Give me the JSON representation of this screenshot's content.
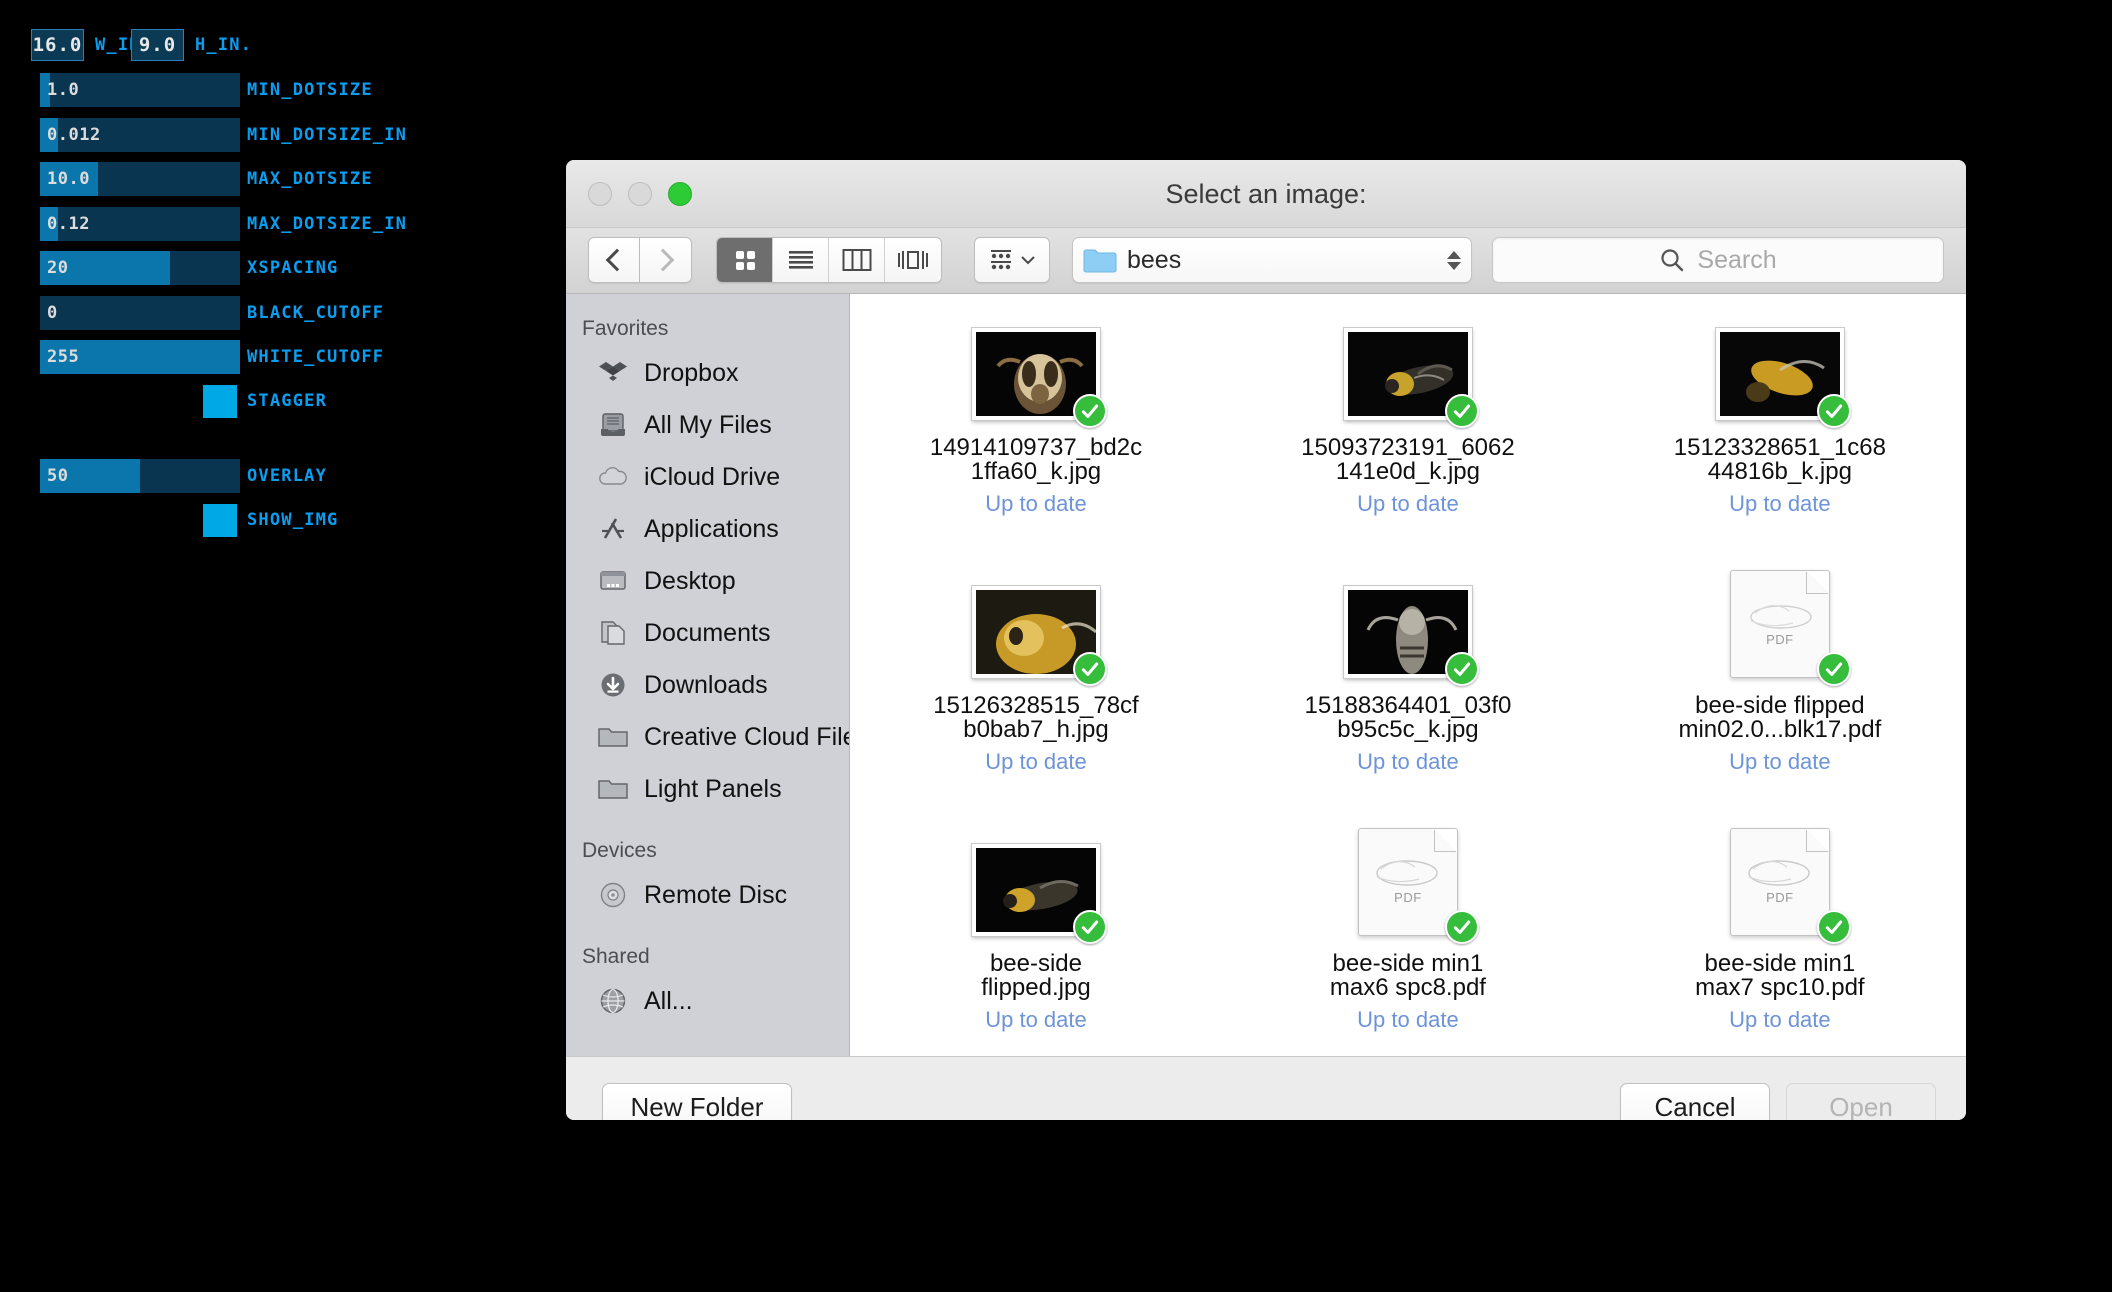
{
  "control_panel": {
    "number_fields": [
      {
        "name": "w_in",
        "value": "16.0",
        "label": "W_IN."
      },
      {
        "name": "h_in",
        "value": "9.0",
        "label": "H_IN."
      }
    ],
    "sliders": [
      {
        "name": "min_dotsize",
        "value": "1.0",
        "label": "MIN_DOTSIZE",
        "fill_pct": 5
      },
      {
        "name": "min_dotsize_in",
        "value": "0.012",
        "label": "MIN_DOTSIZE_IN",
        "fill_pct": 9
      },
      {
        "name": "max_dotsize",
        "value": "10.0",
        "label": "MAX_DOTSIZE",
        "fill_pct": 29
      },
      {
        "name": "max_dotsize_in",
        "value": "0.12",
        "label": "MAX_DOTSIZE_IN",
        "fill_pct": 9
      },
      {
        "name": "xspacing",
        "value": "20",
        "label": "XSPACING",
        "fill_pct": 65
      },
      {
        "name": "black_cutoff",
        "value": "0",
        "label": "BLACK_CUTOFF",
        "fill_pct": 0
      },
      {
        "name": "white_cutoff",
        "value": "255",
        "label": "WHITE_CUTOFF",
        "fill_pct": 100
      },
      {
        "name": "overlay",
        "value": "50",
        "label": "OVERLAY",
        "fill_pct": 50
      }
    ],
    "checkboxes": [
      {
        "name": "stagger",
        "label": "STAGGER",
        "checked": true
      },
      {
        "name": "show_img",
        "label": "SHOW_IMG",
        "checked": true
      }
    ],
    "colors": {
      "accent": "#0b9ef0",
      "slider_track": "#0a3550",
      "slider_fill": "#0b76ab",
      "checkbox": "#00a9e6"
    }
  },
  "dialog": {
    "title": "Select an image:",
    "toolbar": {
      "back_icon": "chevron-left-icon",
      "forward_icon": "chevron-right-icon",
      "view_modes": [
        {
          "name": "icon-view",
          "icon": "grid-icon",
          "active": true
        },
        {
          "name": "list-view",
          "icon": "list-icon",
          "active": false
        },
        {
          "name": "column-view",
          "icon": "columns-icon",
          "active": false
        },
        {
          "name": "cover-flow",
          "icon": "coverflow-icon",
          "active": false
        }
      ],
      "arrange_icon": "arrange-by-icon",
      "arrange_chevron": "chevron-down-icon",
      "path": {
        "folder_icon": "folder-icon",
        "name": "bees",
        "stepper_icon": "stepper-icon"
      },
      "search": {
        "icon": "search-icon",
        "placeholder": "Search",
        "value": ""
      }
    },
    "sidebar": {
      "sections": [
        {
          "name": "favorites",
          "header": "Favorites",
          "items": [
            {
              "label": "Dropbox",
              "icon": "dropbox-icon"
            },
            {
              "label": "All My Files",
              "icon": "all-my-files-icon"
            },
            {
              "label": "iCloud Drive",
              "icon": "icloud-icon"
            },
            {
              "label": "Applications",
              "icon": "applications-icon"
            },
            {
              "label": "Desktop",
              "icon": "desktop-icon"
            },
            {
              "label": "Documents",
              "icon": "documents-icon"
            },
            {
              "label": "Downloads",
              "icon": "downloads-icon"
            },
            {
              "label": "Creative Cloud Files",
              "icon": "folder-icon"
            },
            {
              "label": "Light Panels",
              "icon": "folder-icon"
            }
          ]
        },
        {
          "name": "devices",
          "header": "Devices",
          "items": [
            {
              "label": "Remote Disc",
              "icon": "disc-icon"
            }
          ]
        },
        {
          "name": "shared",
          "header": "Shared",
          "items": [
            {
              "label": "All...",
              "icon": "network-globe-icon"
            }
          ]
        }
      ]
    },
    "files": [
      {
        "name_line1": "14914109737_bd2c",
        "name_line2": "1ffa60_k.jpg",
        "status": "Up to date",
        "kind": "photo",
        "badge": "synced-check-icon"
      },
      {
        "name_line1": "15093723191_6062",
        "name_line2": "141e0d_k.jpg",
        "status": "Up to date",
        "kind": "photo",
        "badge": "synced-check-icon"
      },
      {
        "name_line1": "15123328651_1c68",
        "name_line2": "44816b_k.jpg",
        "status": "Up to date",
        "kind": "photo",
        "badge": "synced-check-icon"
      },
      {
        "name_line1": "15126328515_78cf",
        "name_line2": "b0bab7_h.jpg",
        "status": "Up to date",
        "kind": "photo",
        "badge": "synced-check-icon"
      },
      {
        "name_line1": "15188364401_03f0",
        "name_line2": "b95c5c_k.jpg",
        "status": "Up to date",
        "kind": "photo",
        "badge": "synced-check-icon"
      },
      {
        "name_line1": "bee-side flipped",
        "name_line2": "min02.0...blk17.pdf",
        "status": "Up to date",
        "kind": "pdf",
        "badge": "synced-check-icon",
        "pdf_label": "PDF"
      },
      {
        "name_line1": "bee-side",
        "name_line2": "flipped.jpg",
        "status": "Up to date",
        "kind": "photo",
        "badge": "synced-check-icon"
      },
      {
        "name_line1": "bee-side min1",
        "name_line2": "max6 spc8.pdf",
        "status": "Up to date",
        "kind": "pdf",
        "badge": "synced-check-icon",
        "pdf_label": "PDF"
      },
      {
        "name_line1": "bee-side min1",
        "name_line2": "max7 spc10.pdf",
        "status": "Up to date",
        "kind": "pdf",
        "badge": "synced-check-icon",
        "pdf_label": "PDF"
      }
    ],
    "footer": {
      "new_folder_label": "New Folder",
      "cancel_label": "Cancel",
      "open_label": "Open",
      "open_disabled": true
    },
    "window_controls": {
      "close": "close-button",
      "minimize": "minimize-button",
      "maximize": "maximize-button"
    }
  }
}
